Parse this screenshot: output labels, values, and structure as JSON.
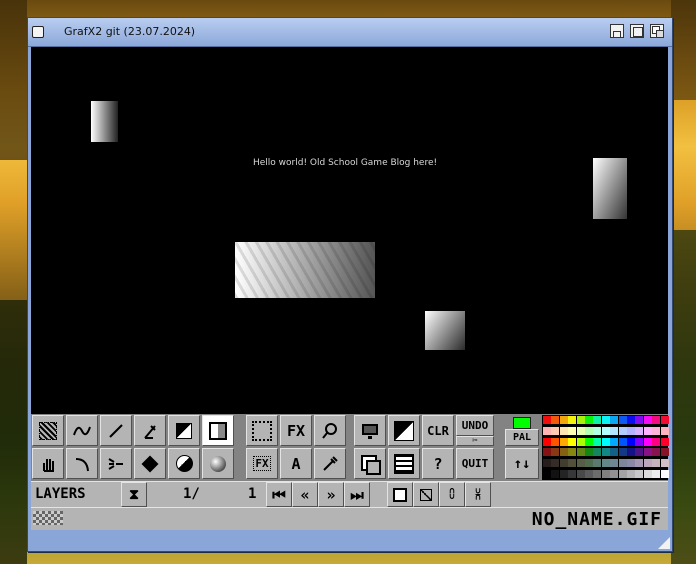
{
  "window": {
    "title": "GrafX2 git (23.07.2024)"
  },
  "canvas": {
    "text": "Hello world! Old School Game Blog here!"
  },
  "toolbar": {
    "fx_label": "FX",
    "fx2_label": "FX",
    "text_label": "A",
    "clr_label": "CLR",
    "undo_label": "UNDO",
    "quit_label": "QUIT",
    "pal_label": "PAL",
    "help_label": "?",
    "scissors_label": "✂"
  },
  "layers": {
    "label": "LAYERS",
    "current": "1/",
    "count": "1"
  },
  "status": {
    "filename": "NO_NAME.GIF"
  },
  "colors": {
    "fore": "#00ff00",
    "background": "#000000",
    "accent": "#8aa6d8"
  }
}
